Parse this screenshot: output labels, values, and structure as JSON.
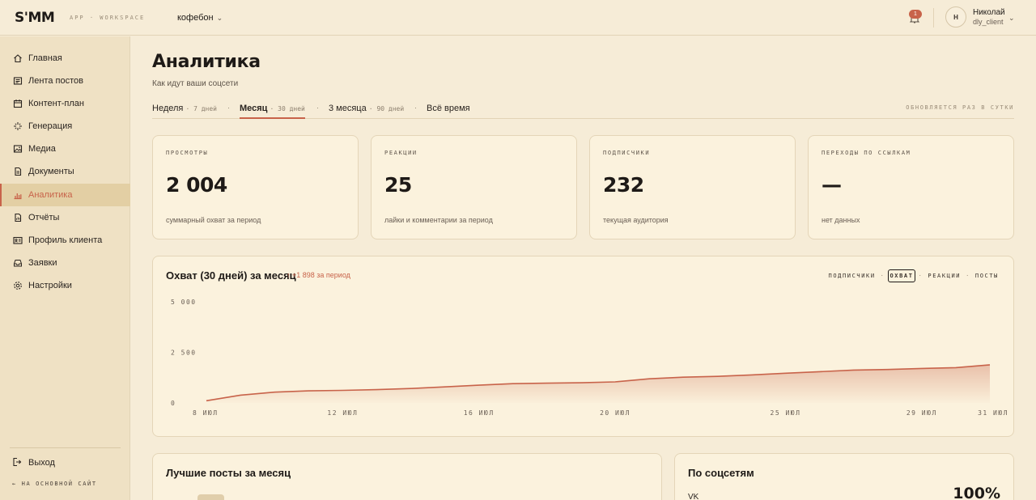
{
  "app": {
    "logo": "S'MM",
    "logo_sub": "APP · WORKSPACE",
    "workspace": "кофебон",
    "notifications_count": "1",
    "user": {
      "initial": "Н",
      "name": "Николай",
      "role": "dly_client"
    }
  },
  "sidebar": {
    "items": [
      {
        "label": "Главная",
        "icon": "home-icon"
      },
      {
        "label": "Лента постов",
        "icon": "feed-icon"
      },
      {
        "label": "Контент-план",
        "icon": "calendar-icon"
      },
      {
        "label": "Генерация",
        "icon": "sparkle-icon"
      },
      {
        "label": "Медиа",
        "icon": "image-icon"
      },
      {
        "label": "Документы",
        "icon": "document-icon"
      },
      {
        "label": "Аналитика",
        "icon": "analytics-icon",
        "active": true
      },
      {
        "label": "Отчёты",
        "icon": "report-icon"
      },
      {
        "label": "Профиль клиента",
        "icon": "profile-card-icon"
      },
      {
        "label": "Заявки",
        "icon": "inbox-icon"
      },
      {
        "label": "Настройки",
        "icon": "gear-icon"
      }
    ],
    "logout": "Выход",
    "main_site": "← НА ОСНОВНОЙ САЙТ"
  },
  "page": {
    "title": "Аналитика",
    "subtitle": "Как идут ваши соцсети",
    "tabs": [
      {
        "label": "Неделя",
        "meta": "7 дней"
      },
      {
        "label": "Месяц",
        "meta": "30 дней",
        "active": true
      },
      {
        "label": "3 месяца",
        "meta": "90 дней"
      },
      {
        "label": "Всё время",
        "meta": ""
      }
    ],
    "update_note": "ОБНОВЛЯЕТСЯ РАЗ В СУТКИ"
  },
  "stats": [
    {
      "label": "ПРОСМОТРЫ",
      "value": "2 004",
      "note": "суммарный охват за период"
    },
    {
      "label": "РЕАКЦИИ",
      "value": "25",
      "note": "лайки и комментарии за период"
    },
    {
      "label": "ПОДПИСЧИКИ",
      "value": "232",
      "note": "текущая аудитория"
    },
    {
      "label": "ПЕРЕХОДЫ ПО ССЫЛКАМ",
      "value": "—",
      "note": "нет данных"
    }
  ],
  "chart_section": {
    "title": "Охват (30 дней) за месяц",
    "delta": "↑ +1 898 за период",
    "metrics": [
      "ПОДПИСЧИКИ",
      "ОХВАТ",
      "РЕАКЦИИ",
      "ПОСТЫ"
    ],
    "active_metric": "ОХВАТ"
  },
  "chart_data": {
    "type": "area",
    "title": "Охват (30 дней) за месяц",
    "x_ticks": [
      "8 июл",
      "12 июл",
      "16 июл",
      "20 июл",
      "25 июл",
      "29 июл",
      "31 июл"
    ],
    "y_ticks": [
      "5 000",
      "2 500",
      "0"
    ],
    "ylim": [
      0,
      5000
    ],
    "series": [
      {
        "color": "#c8634a",
        "x": [
          "8 июл",
          "9 июл",
          "10 июл",
          "11 июл",
          "12 июл",
          "13 июл",
          "14 июл",
          "15 июл",
          "16 июл",
          "17 июл",
          "18 июл",
          "19 июл",
          "20 июл",
          "21 июл",
          "22 июл",
          "23 июл",
          "24 июл",
          "25 июл",
          "26 июл",
          "27 июл",
          "28 июл",
          "29 июл",
          "30 июл",
          "31 июл"
        ],
        "values": [
          106,
          383,
          534,
          597,
          620,
          656,
          714,
          794,
          878,
          954,
          976,
          997,
          1041,
          1193,
          1273,
          1313,
          1383,
          1467,
          1545,
          1624,
          1652,
          1703,
          1744,
          1884
        ]
      }
    ],
    "grid": false
  },
  "top_posts": {
    "title": "Лучшие посты за месяц"
  },
  "by_network": {
    "title": "По соцсетям",
    "rows": [
      {
        "name": "VK",
        "percent": "100%"
      }
    ]
  }
}
